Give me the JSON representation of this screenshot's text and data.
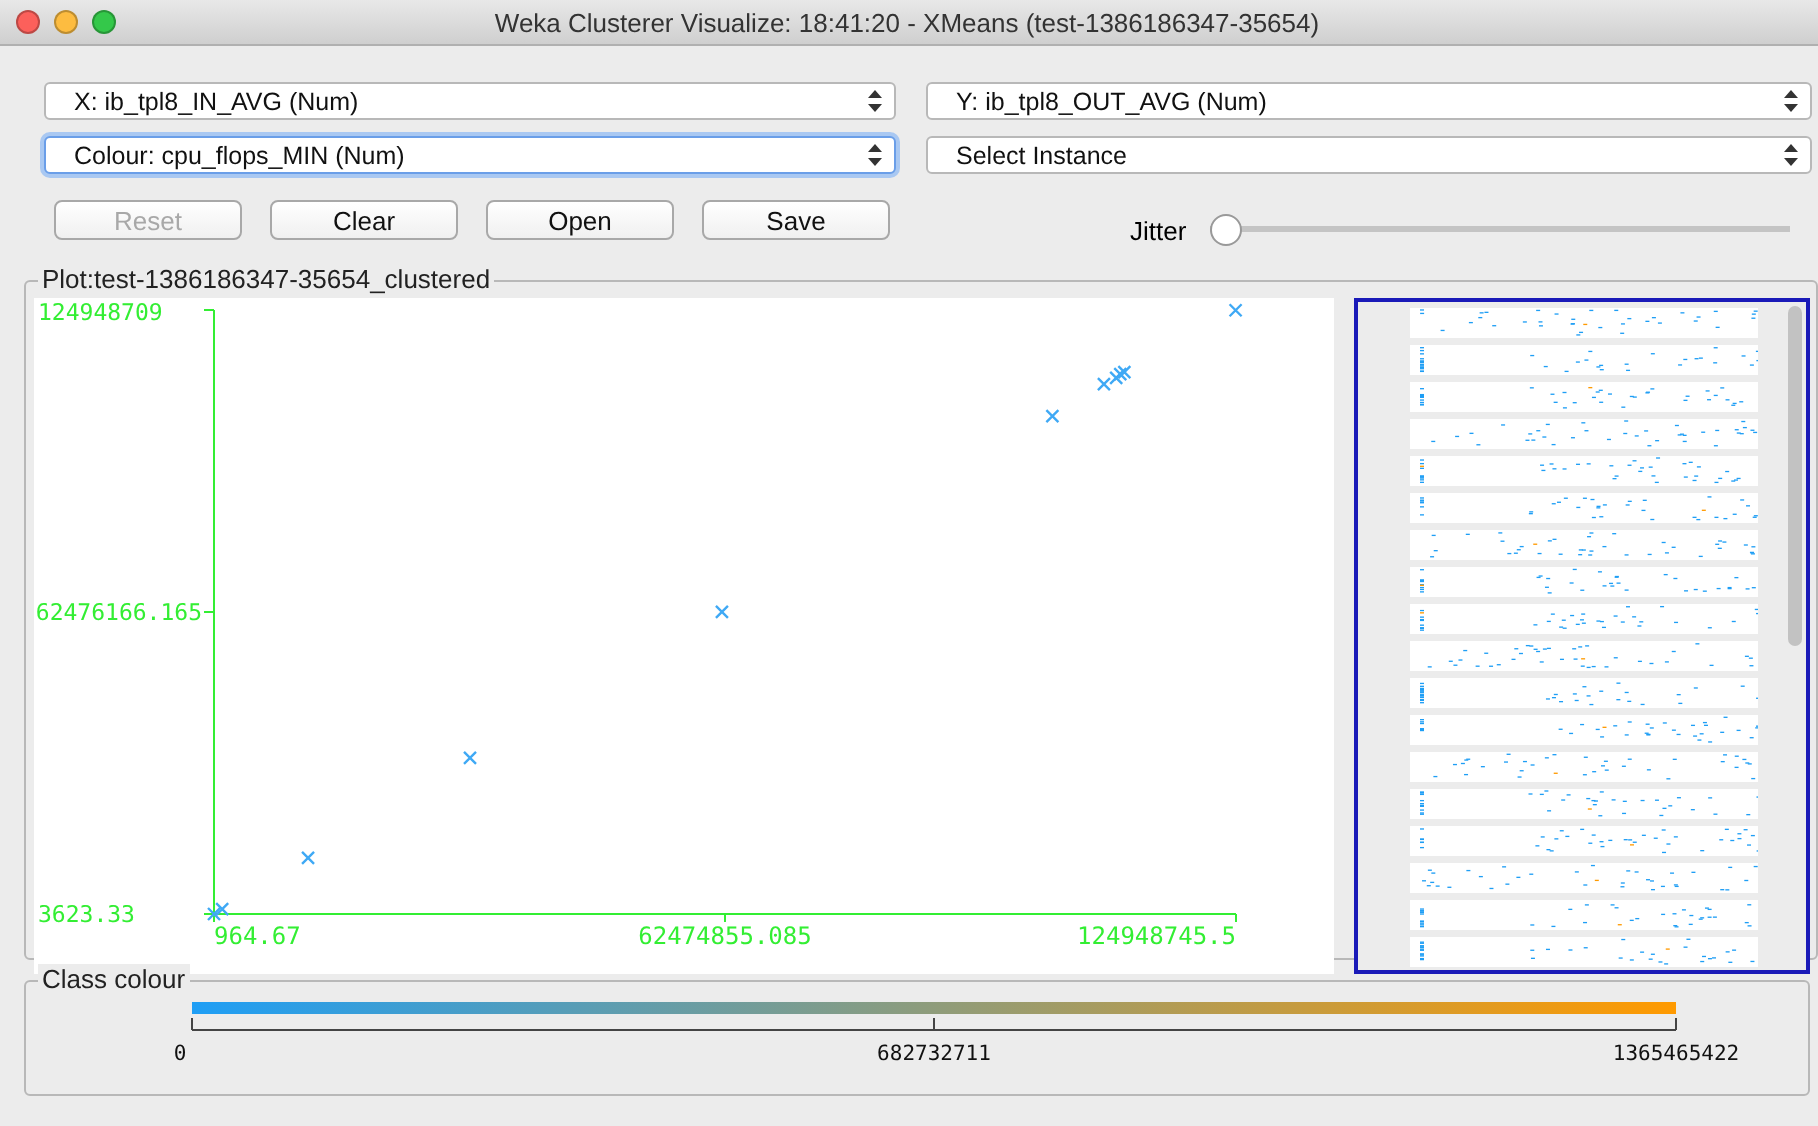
{
  "window": {
    "title": "Weka Clusterer Visualize: 18:41:20 - XMeans (test-1386186347-35654)"
  },
  "selectors": [
    {
      "label": "X: ib_tpl8_IN_AVG (Num)",
      "focused": false
    },
    {
      "label": "Y: ib_tpl8_OUT_AVG (Num)",
      "focused": false
    },
    {
      "label": "Colour: cpu_flops_MIN (Num)",
      "focused": true
    },
    {
      "label": "Select Instance",
      "focused": false
    }
  ],
  "buttons": [
    {
      "label": "Reset",
      "disabled": true
    },
    {
      "label": "Clear",
      "disabled": false
    },
    {
      "label": "Open",
      "disabled": false
    },
    {
      "label": "Save",
      "disabled": false
    }
  ],
  "jitter": {
    "label": "Jitter",
    "level": 0
  },
  "plot": {
    "title": "Plot:test-1386186347-35654_clustered",
    "chart_data": {
      "type": "scatter",
      "xlim": [
        964.67,
        124948745.5
      ],
      "ylim": [
        3623.33,
        124948709
      ],
      "xticks": [
        {
          "value": 964.67,
          "label": "964.67"
        },
        {
          "value": 62474855.085,
          "label": "62474855.085"
        },
        {
          "value": 124948745.5,
          "label": "124948745.5"
        }
      ],
      "yticks": [
        3623.33,
        62476166.165,
        124948709
      ],
      "series": [
        {
          "color": "#3fa9f5",
          "x": [
            1000,
            1000000,
            11500000,
            31300000,
            62100000,
            102500000,
            108800000,
            110300000,
            110800000,
            111300000,
            124900000
          ],
          "values": [
            4000,
            1000000,
            11600000,
            32300000,
            62500000,
            103000000,
            109600000,
            110900000,
            111700000,
            112100000,
            124900000
          ]
        }
      ]
    }
  },
  "legend": {
    "title": "Class colour",
    "labels": [
      "0",
      "682732711",
      "1365465422"
    ]
  }
}
